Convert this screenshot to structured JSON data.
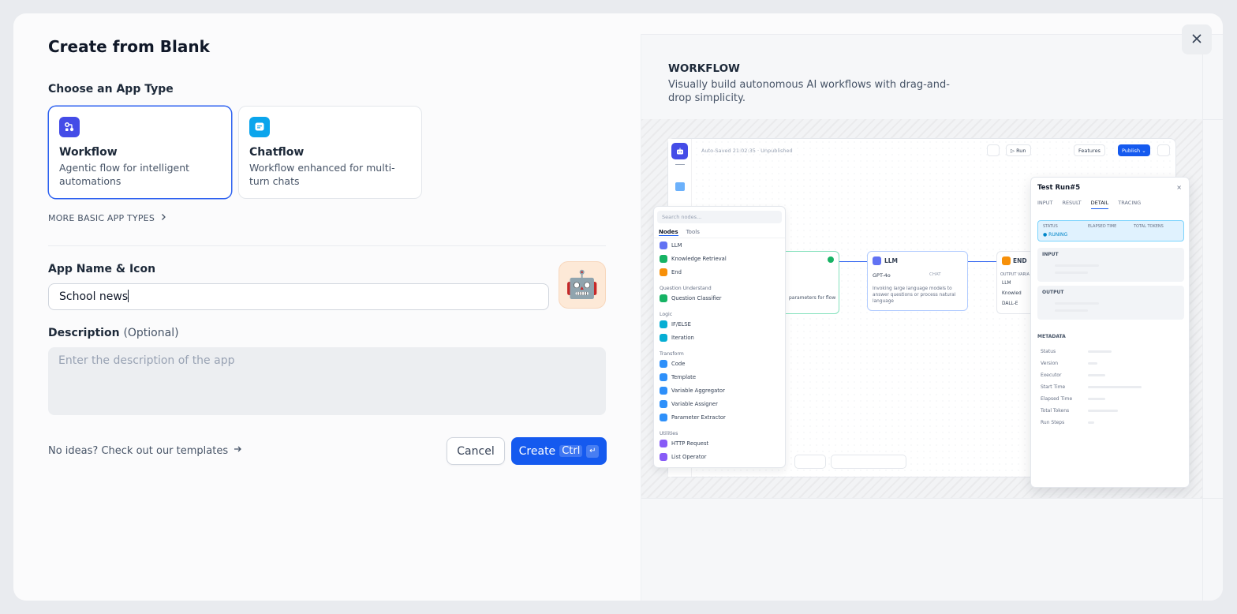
{
  "dialog": {
    "title": "Create from Blank",
    "close_icon": "close-icon"
  },
  "app_type": {
    "label": "Choose an App Type",
    "options": [
      {
        "title": "Workflow",
        "description": "Agentic flow for intelligent automations",
        "selected": true,
        "icon": "workflow-icon",
        "color": "#444ce7"
      },
      {
        "title": "Chatflow",
        "description": "Workflow enhanced for multi-turn chats",
        "selected": false,
        "icon": "chatflow-icon",
        "color": "#0ba5ec"
      }
    ],
    "more_label": "MORE BASIC APP TYPES"
  },
  "app_name": {
    "label": "App Name & Icon",
    "value": "School news",
    "icon_emoji": "🤖"
  },
  "description": {
    "label": "Description",
    "optional_label": "(Optional)",
    "placeholder": "Enter the description of the app"
  },
  "footer": {
    "templates_link": "No ideas? Check out our templates",
    "cancel_label": "Cancel",
    "create_label": "Create",
    "shortcut_ctrl": "Ctrl",
    "shortcut_enter": "↵",
    "accent": "#155aef"
  },
  "preview": {
    "type_label": "WORKFLOW",
    "type_description": "Visually build autonomous AI workflows with drag-and-drop simplicity.",
    "autosave": "Auto-Saved 21:02:35 · Unpublished",
    "toolbar": {
      "run": "Run",
      "features": "Features",
      "publish": "Publish"
    },
    "node_panel": {
      "search_placeholder": "Search nodes...",
      "tabs": [
        "Nodes",
        "Tools"
      ],
      "groups": [
        {
          "category": "",
          "items": [
            {
              "label": "LLM",
              "color": "#6172f3"
            },
            {
              "label": "Knowledge Retrieval",
              "color": "#16b364"
            },
            {
              "label": "End",
              "color": "#f79009"
            }
          ]
        },
        {
          "category": "Question Understand",
          "items": [
            {
              "label": "Question Classifier",
              "color": "#16b364"
            }
          ]
        },
        {
          "category": "Logic",
          "items": [
            {
              "label": "IF/ELSE",
              "color": "#06aed4"
            },
            {
              "label": "Iteration",
              "color": "#06aed4"
            }
          ]
        },
        {
          "category": "Transform",
          "items": [
            {
              "label": "Code",
              "color": "#2e90fa"
            },
            {
              "label": "Template",
              "color": "#2e90fa"
            },
            {
              "label": "Variable Aggregator",
              "color": "#2e90fa"
            },
            {
              "label": "Variable Assigner",
              "color": "#2e90fa"
            },
            {
              "label": "Parameter Extractor",
              "color": "#2e90fa"
            }
          ]
        },
        {
          "category": "Utilities",
          "items": [
            {
              "label": "HTTP Request",
              "color": "#875bf7"
            },
            {
              "label": "List Operator",
              "color": "#875bf7"
            }
          ]
        }
      ]
    },
    "llm_node": {
      "title": "LLM",
      "model": "GPT-4o",
      "mode": "CHAT",
      "description": "Invoking large language models to answer questions or process natural language"
    },
    "first_node_desc": "parameters for flow",
    "end_node": {
      "title": "END",
      "output_label": "OUTPUT VARIA",
      "vars": [
        "LLM",
        "Knowled",
        "DALL-E"
      ]
    },
    "test_run": {
      "title": "Test Run#5",
      "tabs": [
        "INPUT",
        "RESULT",
        "DETAIL",
        "TRACING"
      ],
      "active_tab": "DETAIL",
      "status_headers": [
        "STATUS",
        "ELAPSED TIME",
        "TOTAL TOKENS"
      ],
      "status_value": "RUNING",
      "input_label": "INPUT",
      "output_label": "OUTPUT",
      "metadata_label": "METADATA",
      "metadata_rows": [
        "Status",
        "Version",
        "Executor",
        "Start Time",
        "Elapsed Time",
        "Total Tokens",
        "Run Steps"
      ]
    }
  }
}
